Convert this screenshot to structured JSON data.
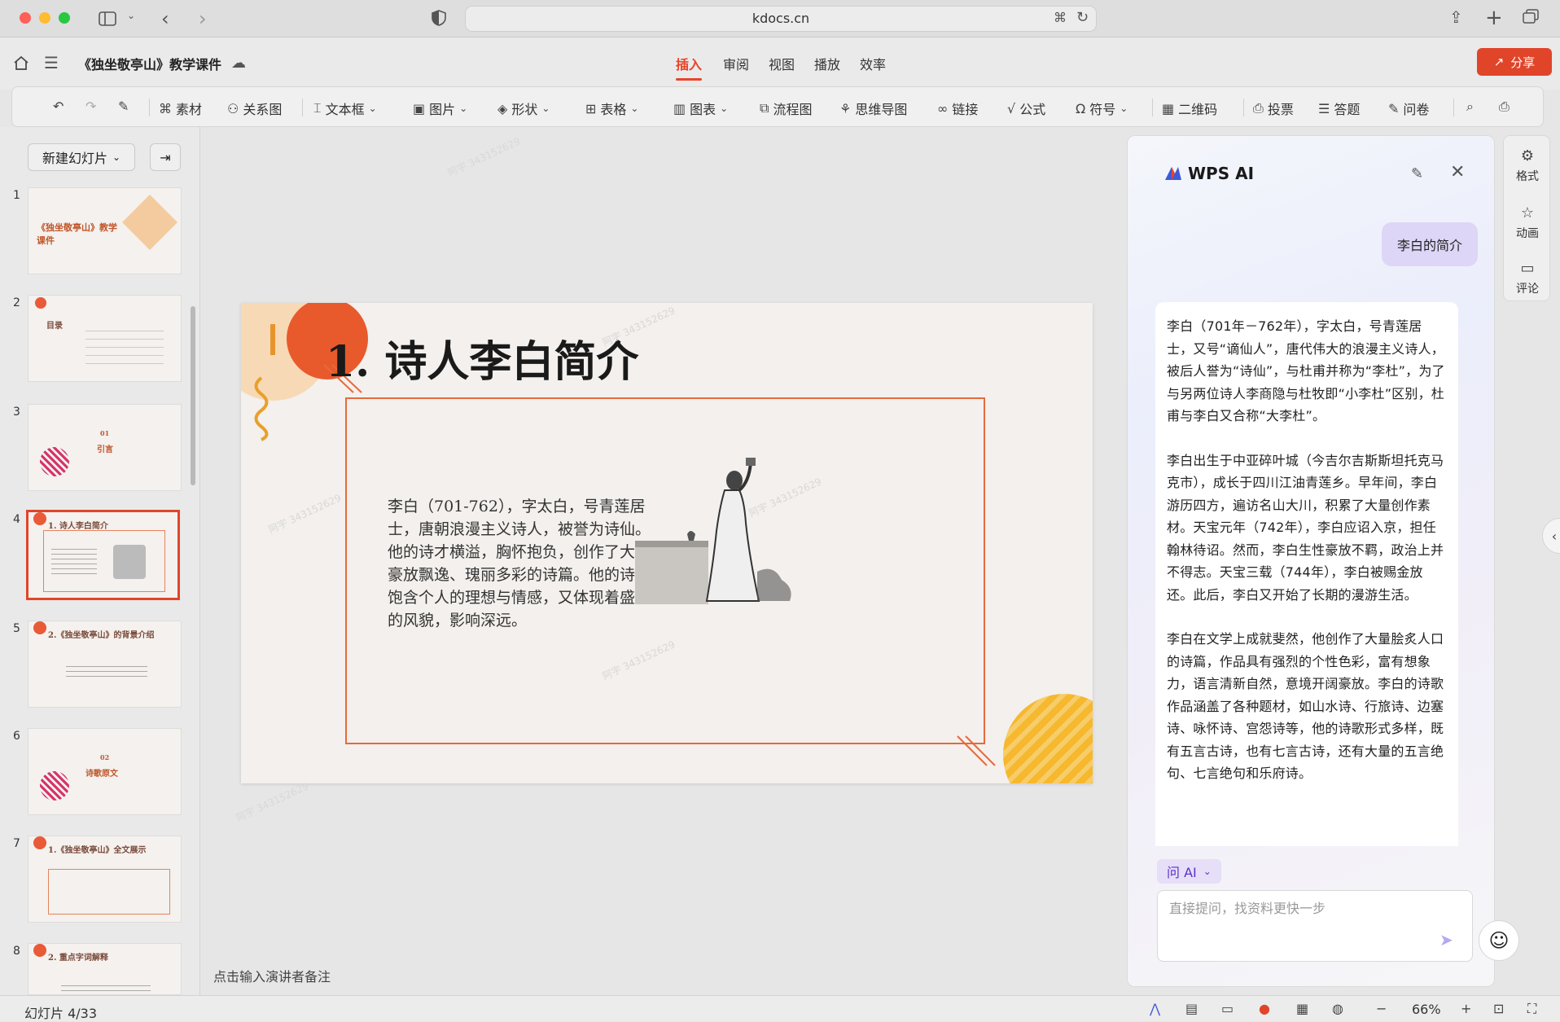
{
  "browser": {
    "url": "kdocs.cn"
  },
  "app": {
    "doc_title": "《独坐敬亭山》教学课件",
    "menu_tabs": [
      "插入",
      "审阅",
      "视图",
      "播放",
      "效率"
    ],
    "active_tab": "插入",
    "share_label": "分享"
  },
  "toolbar": {
    "items": [
      "素材",
      "关系图",
      "文本框",
      "图片",
      "形状",
      "表格",
      "图表",
      "流程图",
      "思维导图",
      "链接",
      "公式",
      "符号",
      "二维码",
      "投票",
      "答题",
      "问卷"
    ]
  },
  "slides_panel": {
    "new_slide_label": "新建幻灯片",
    "thumbnails": [
      {
        "num": "1",
        "title": "《独坐敬亭山》教学课件"
      },
      {
        "num": "2",
        "title": "目录"
      },
      {
        "num": "3",
        "title": "引言",
        "sub": "01"
      },
      {
        "num": "4",
        "title": "1. 诗人李白简介"
      },
      {
        "num": "5",
        "title": "2.《独坐敬亭山》的背景介绍"
      },
      {
        "num": "6",
        "title": "诗歌原文",
        "sub": "02"
      },
      {
        "num": "7",
        "title": "1.《独坐敬亭山》全文展示"
      },
      {
        "num": "8",
        "title": "2. 重点字词解释"
      }
    ]
  },
  "slide": {
    "title": "1. 诗人李白简介",
    "body": "李白（701-762），字太白，号青莲居士，唐朝浪漫主义诗人，被誉为诗仙。他的诗才横溢，胸怀抱负，创作了大量豪放飘逸、瑰丽多彩的诗篇。他的诗既饱含个人的理想与情感，又体现着盛唐的风貌，影响深远。"
  },
  "notes_placeholder": "点击输入演讲者备注",
  "ai_panel": {
    "title": "WPS AI",
    "user_message": "李白的简介",
    "reply_paragraphs": [
      "李白（701年－762年），字太白，号青莲居士，又号“谪仙人”，唐代伟大的浪漫主义诗人，被后人誉为“诗仙”，与杜甫并称为“李杜”，为了与另两位诗人李商隐与杜牧即“小李杜”区别，杜甫与李白又合称“大李杜”。",
      "李白出生于中亚碎叶城（今吉尔吉斯斯坦托克马克市），成长于四川江油青莲乡。早年间，李白游历四方，遍访名山大川，积累了大量创作素材。天宝元年（742年），李白应诏入京，担任翰林待诏。然而，李白生性豪放不羁，政治上并不得志。天宝三载（744年），李白被赐金放还。此后，李白又开始了长期的漫游生活。",
      "李白在文学上成就斐然，他创作了大量脍炙人口的诗篇，作品具有强烈的个性色彩，富有想象力，语言清新自然，意境开阔豪放。李白的诗歌作品涵盖了各种题材，如山水诗、行旅诗、边塞诗、咏怀诗、宫怨诗等，他的诗歌形式多样，既有五言古诗，也有七言古诗，还有大量的五言绝句、七言绝句和乐府诗。"
    ],
    "ask_ai_label": "问 AI",
    "input_placeholder": "直接提问，找资料更快一步"
  },
  "right_rail": {
    "items": [
      "格式",
      "动画",
      "评论"
    ]
  },
  "status_bar": {
    "slide_count": "幻灯片 4/33",
    "zoom": "66%"
  },
  "watermark": "阿宇 343152629",
  "colors": {
    "accent": "#e0452a",
    "ai_purple": "#5a32c8"
  }
}
